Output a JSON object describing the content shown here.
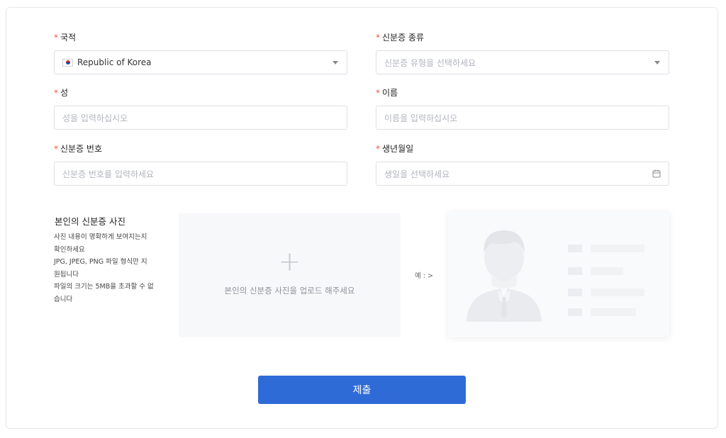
{
  "form": {
    "nationality": {
      "label": "국적",
      "value": "Republic of Korea",
      "flag_icon": "kr-flag-icon"
    },
    "id_type": {
      "label": "신분증 종류",
      "placeholder": "신분증 유형을 선택하세요"
    },
    "last_name": {
      "label": "성",
      "placeholder": "성을 입력하십시오"
    },
    "first_name": {
      "label": "이름",
      "placeholder": "이름을 입력하십시오"
    },
    "id_number": {
      "label": "신분증 번호",
      "placeholder": "신분증 번호를 입력하세요"
    },
    "birth_date": {
      "label": "생년월일",
      "placeholder": "생일을 선택하세요",
      "icon": "calendar-icon"
    },
    "required_mark": "*"
  },
  "photo": {
    "title": "본인의 신분증 사진",
    "desc_lines": [
      "사진 내용이 명확하게 보여지는지",
      "확인하세요",
      "JPG, JPEG, PNG 파일 형식만 지",
      "원됩니다",
      "파일의 크기는 5MB을 초과할 수 없",
      "습니다"
    ],
    "upload_hint": "본인의 신분증 사진을 업로드 해주세요",
    "example_label": "예 : >"
  },
  "submit_label": "제출",
  "colors": {
    "primary": "#2f6bd7",
    "required": "#f5543e",
    "border": "#dcdfe6"
  }
}
